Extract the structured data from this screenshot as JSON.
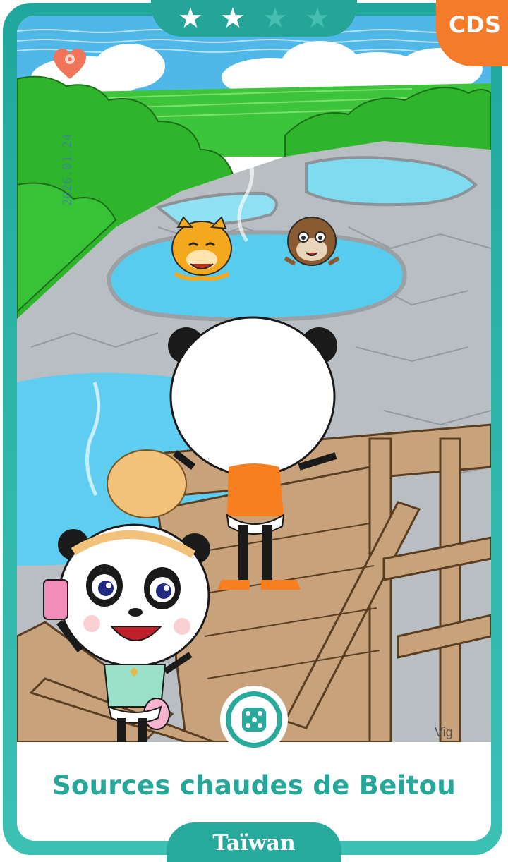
{
  "card": {
    "title": "Sources chaudes de Beitou",
    "country": "Taïwan",
    "badge": "CDS",
    "artist_signature": "Vig",
    "date_stamp": "2026.01.24",
    "rating": {
      "filled": 2,
      "total": 4
    },
    "action_icon": "dice-icon",
    "favorite_icon": "heart-location-icon"
  },
  "colors": {
    "frame_teal": "#27a99b",
    "title_teal": "#25a899",
    "badge_orange": "#f47b2a",
    "star_filled": "#ffffff",
    "star_empty": "#3fb9ac"
  }
}
